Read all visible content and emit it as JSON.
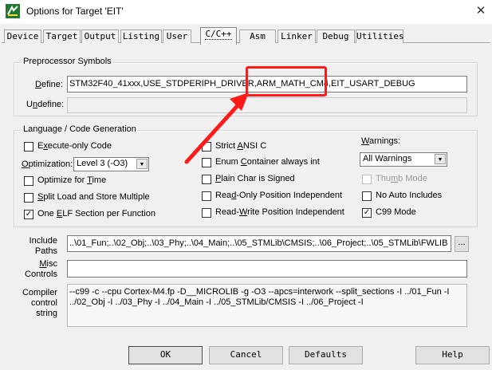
{
  "window": {
    "title": "Options for Target 'EIT'",
    "close_glyph": "✕"
  },
  "tabs": [
    {
      "label": "Device"
    },
    {
      "label": "Target"
    },
    {
      "label": "Output"
    },
    {
      "label": "Listing"
    },
    {
      "label": "User"
    },
    {
      "label": "C/C++"
    },
    {
      "label": "Asm"
    },
    {
      "label": "Linker"
    },
    {
      "label": "Debug"
    },
    {
      "label": "Utilities"
    }
  ],
  "preprocessor": {
    "legend": "Preprocessor Symbols",
    "define_label_pre": "",
    "define_label_u": "D",
    "define_label_post": "efine:",
    "define_value": "STM32F40_41xxx,USE_STDPERIPH_DRIVER,ARM_MATH_CM4,EIT_USART_DEBUG",
    "undefine_label_pre": "U",
    "undefine_label_u": "n",
    "undefine_label_post": "define:",
    "undefine_value": ""
  },
  "language": {
    "legend": "Language / Code Generation",
    "execute_only": {
      "pre": "E",
      "u": "x",
      "post": "ecute-only Code",
      "checked": false
    },
    "optimization_label_pre": "",
    "optimization_label_u": "O",
    "optimization_label_post": "ptimization:",
    "optimization_value": "Level 3 (-O3)",
    "optimize_time": {
      "pre": "Optimize for ",
      "u": "T",
      "post": "ime",
      "checked": false
    },
    "split_load": {
      "pre": "",
      "u": "S",
      "post": "plit Load and Store Multiple",
      "checked": false
    },
    "one_elf": {
      "pre": "One ",
      "u": "E",
      "post": "LF Section per Function",
      "checked": true
    },
    "strict_ansi": {
      "pre": "Strict ",
      "u": "A",
      "post": "NSI C",
      "checked": false
    },
    "enum_container": {
      "pre": "Enum ",
      "u": "C",
      "post": "ontainer always int",
      "checked": false
    },
    "plain_char": {
      "pre": "",
      "u": "P",
      "post": "lain Char is Signed",
      "checked": false
    },
    "read_only_pi": {
      "pre": "Rea",
      "u": "d",
      "post": "-Only Position Independent",
      "checked": false
    },
    "read_write_pi": {
      "pre": "Read-",
      "u": "W",
      "post": "rite Position Independent",
      "checked": false
    },
    "warnings_label_pre": "",
    "warnings_label_u": "W",
    "warnings_label_post": "arnings:",
    "warnings_value": "All Warnings",
    "thumb_mode": {
      "pre": "Thu",
      "u": "m",
      "post": "b Mode",
      "checked": false,
      "disabled": true
    },
    "no_auto_includes": {
      "pre": "No Auto Includes",
      "u": "",
      "post": "",
      "checked": false
    },
    "c99_mode": {
      "pre": "C99 Mode",
      "u": "",
      "post": "",
      "checked": true
    }
  },
  "paths": {
    "include_label_l1": "Include",
    "include_label_l2": "Paths",
    "include_value": "..\\01_Fun;..\\02_Obj;..\\03_Phy;..\\04_Main;..\\05_STMLib\\CMSIS;..\\06_Project;..\\05_STMLib\\FWLIB",
    "browse_label": "...",
    "misc_label_l1_u": "M",
    "misc_label_l1_post": "isc",
    "misc_label_l2": "Controls",
    "misc_value": "",
    "compiler_label_l1": "Compiler",
    "compiler_label_l2": "control",
    "compiler_label_l3": "string",
    "compiler_value": "--c99 -c --cpu Cortex-M4.fp -D__MICROLIB -g -O3 --apcs=interwork --split_sections -I ../01_Fun -I ../02_Obj -I ../03_Phy -I ../04_Main -I ../05_STMLib/CMSIS -I ../06_Project -I"
  },
  "buttons": {
    "ok": "OK",
    "cancel": "Cancel",
    "defaults": "Defaults",
    "help": "Help"
  },
  "colors": {
    "annotation": "#ff1a1a",
    "app_icon_bg": "#1f7a2e"
  }
}
